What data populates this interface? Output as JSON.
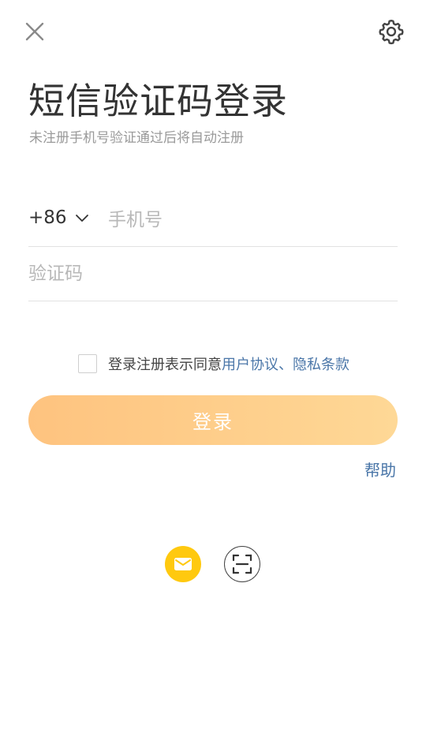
{
  "header": {
    "close_icon": "close-icon",
    "settings_icon": "gear-icon"
  },
  "title": "短信验证码登录",
  "subtitle": "未注册手机号验证通过后将自动注册",
  "phone": {
    "country_code": "+86",
    "placeholder": "手机号",
    "value": ""
  },
  "code": {
    "placeholder": "验证码",
    "value": ""
  },
  "agreement": {
    "checked": false,
    "prefix": "登录注册表示同意",
    "user_agreement": "用户协议",
    "separator": "、",
    "privacy": "隐私条款"
  },
  "login_button": "登录",
  "help_link": "帮助",
  "alt_login": {
    "mail_icon": "mail-icon",
    "scan_icon": "scan-icon"
  },
  "colors": {
    "accent_link": "#4a76a8",
    "button_gradient_start": "#fec37f",
    "button_gradient_end": "#fed896",
    "mail_icon_bg": "#ffc90f"
  }
}
